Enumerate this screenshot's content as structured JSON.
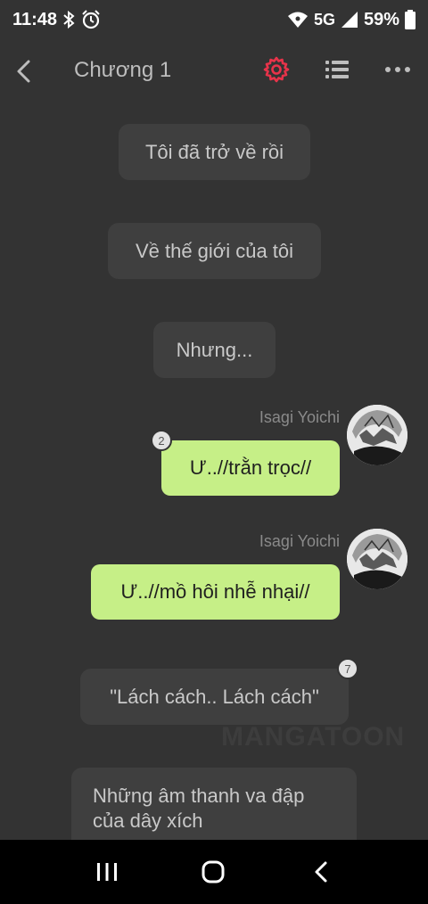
{
  "status_bar": {
    "time": "11:48",
    "network": "5G",
    "battery": "59%"
  },
  "header": {
    "title": "Chương 1",
    "accent_color": "#e8334a"
  },
  "chat": {
    "narrations": [
      {
        "text": "Tôi đã trở về rồi"
      },
      {
        "text": "Về thế giới của tôi"
      },
      {
        "text": "Nhưng..."
      },
      {
        "text": "\"Lách cách.. Lách cách\"",
        "comment_count": "7"
      },
      {
        "text": "Những âm thanh va đập của dây xích"
      }
    ],
    "messages": [
      {
        "sender": "Isagi Yoichi",
        "text": "Ư..//trằn trọc//",
        "comment_count": "2"
      },
      {
        "sender": "Isagi Yoichi",
        "text": "Ư..//mồ hôi nhễ nhại//"
      }
    ],
    "bubble_color": "#c6ef87",
    "watermark": "MANGATOON"
  }
}
